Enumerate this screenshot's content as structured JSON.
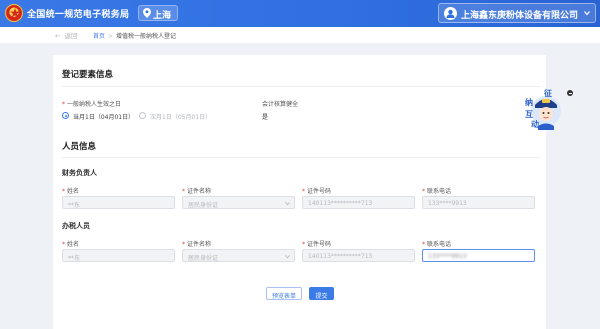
{
  "header": {
    "brand": "全国统一规范电子税务局",
    "region": "上海",
    "company": "上海鑫东庚粉体设备有限公司",
    "accent": "#2f6fe0"
  },
  "breadcrumb": {
    "back": "返回",
    "home": "首页",
    "current": "增值税一般纳税人登记"
  },
  "registration": {
    "title": "登记要素信息",
    "effective_date_label": "一般纳税人生效之日",
    "option_current": "当月1日（04月01日）",
    "option_next": "次月1日（05月01日）",
    "accounting_label": "会计核算健全",
    "accounting_value": "是"
  },
  "personnel": {
    "title": "人员信息",
    "finance": {
      "title": "财务负责人",
      "name_label": "姓名",
      "name_value": "**东",
      "id_type_label": "证件名称",
      "id_type_value": "居民身份证",
      "id_number_label": "证件号码",
      "id_number_value": "140113**********713",
      "phone_label": "联系电话",
      "phone_value": "133****9913"
    },
    "tax": {
      "title": "办税人员",
      "name_label": "姓名",
      "name_value": "**东",
      "id_type_label": "证件名称",
      "id_type_value": "居民身份证",
      "id_number_label": "证件号码",
      "id_number_value": "140113**********713",
      "phone_label": "联系电话",
      "phone_value": "133****9913"
    }
  },
  "actions": {
    "preview": "预览表单",
    "submit": "提交"
  },
  "mascot": {
    "chars": [
      "征",
      "纳",
      "互",
      "动"
    ]
  }
}
